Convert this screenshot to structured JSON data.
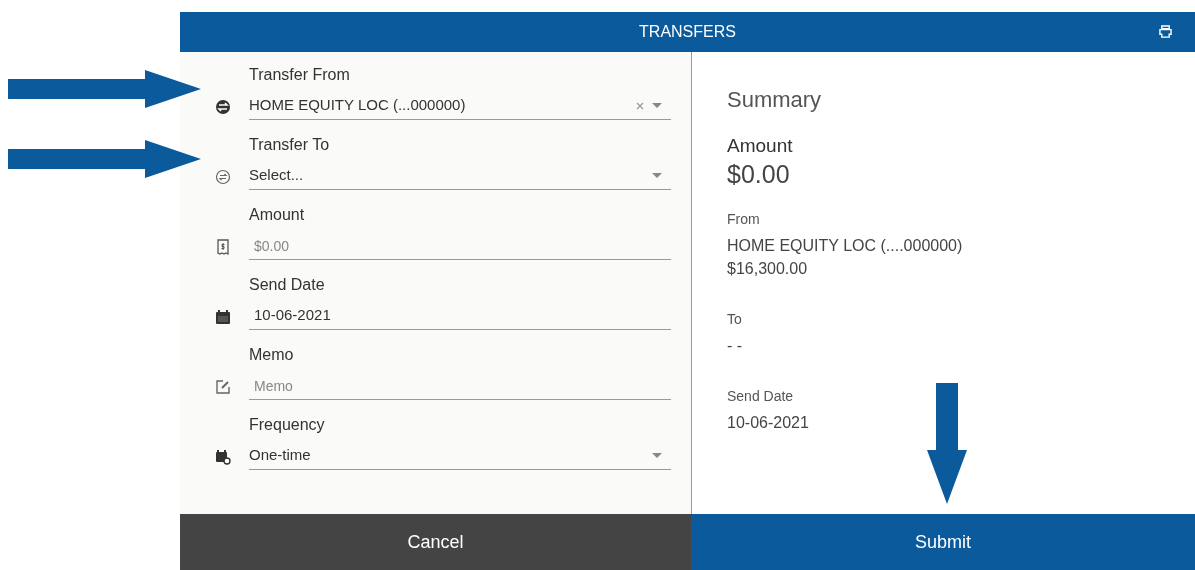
{
  "header": {
    "title": "TRANSFERS"
  },
  "fields": [
    {
      "kind": "select",
      "label": "Transfer From",
      "value": "HOME EQUITY LOC (...000000)",
      "clearable": true
    },
    {
      "kind": "select",
      "label": "Transfer To",
      "value": "Select...",
      "clearable": false
    },
    {
      "kind": "input",
      "label": "Amount",
      "placeholder": "$0.00"
    },
    {
      "kind": "date",
      "label": "Send Date",
      "value": "10-06-2021"
    },
    {
      "kind": "input",
      "label": "Memo",
      "placeholder": "Memo"
    },
    {
      "kind": "select",
      "label": "Frequency",
      "value": "One-time",
      "clearable": false
    }
  ],
  "summary": {
    "title": "Summary",
    "amount_label": "Amount",
    "amount": "$0.00",
    "items": [
      {
        "label": "From",
        "lines": [
          "HOME EQUITY LOC (....000000)",
          "$16,300.00"
        ]
      },
      {
        "label": "To",
        "lines": [
          "- -"
        ]
      },
      {
        "label": "Send Date",
        "lines": [
          "10-06-2021"
        ]
      }
    ]
  },
  "footer": {
    "cancel": "Cancel",
    "submit": "Submit"
  }
}
